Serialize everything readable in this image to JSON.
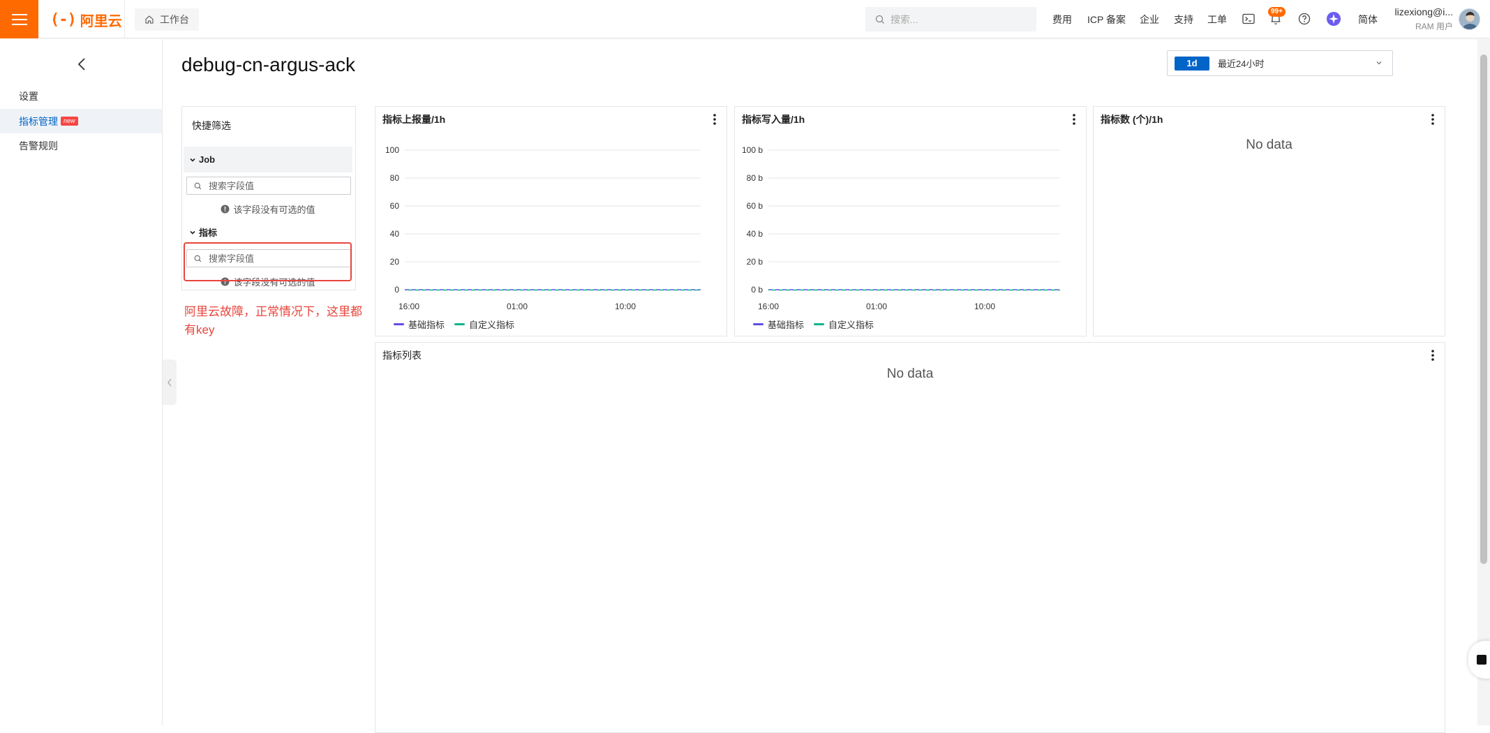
{
  "topbar": {
    "logo_text": "阿里云",
    "logo_mark": "(-)",
    "workbench_label": "工作台",
    "search_placeholder": "搜索...",
    "nav": {
      "billing": "费用",
      "icp": "ICP 备案",
      "enterprise": "企业",
      "support": "支持",
      "tickets": "工单",
      "language": "简体"
    },
    "notifications_badge": "99+",
    "user_name": "lizexiong@i...",
    "user_role": "RAM 用户"
  },
  "sidebar": {
    "items": [
      {
        "label": "设置",
        "active": false
      },
      {
        "label": "指标管理",
        "active": true,
        "badge": "new"
      },
      {
        "label": "告警规则",
        "active": false
      }
    ]
  },
  "main": {
    "title": "debug-cn-argus-ack",
    "time_range": {
      "tag": "1d",
      "label": "最近24小时"
    }
  },
  "quick_filter": {
    "title": "快捷筛选",
    "sections": [
      {
        "name": "Job",
        "search_placeholder": "搜索字段值",
        "empty_text": "该字段没有可选的值"
      },
      {
        "name": "指标",
        "search_placeholder": "搜索字段值",
        "empty_text": "该字段没有可选的值"
      }
    ]
  },
  "annotation": "阿里云故障，正常情况下，这里都有key",
  "panels": {
    "report_volume": {
      "title": "指标上报量/1h",
      "legend": [
        "基础指标",
        "自定义指标"
      ]
    },
    "write_volume": {
      "title": "指标写入量/1h",
      "legend": [
        "基础指标",
        "自定义指标"
      ]
    },
    "metric_count": {
      "title": "指标数 (个)/1h",
      "no_data": "No data"
    },
    "metric_list": {
      "title": "指标列表",
      "no_data": "No data"
    }
  },
  "colors": {
    "brand": "#ff6a00",
    "primary": "#0064c8",
    "series_basic": "#5f4de6",
    "series_custom": "#11b589",
    "annotation": "#e8453c"
  },
  "chart_data": [
    {
      "type": "line",
      "title": "指标上报量/1h",
      "x_ticks": [
        "16:00",
        "01:00",
        "10:00"
      ],
      "y_ticks": [
        "0",
        "20",
        "40",
        "60",
        "80",
        "100"
      ],
      "ylim": [
        0,
        100
      ],
      "series": [
        {
          "name": "基础指标",
          "values": [
            0,
            0,
            0
          ]
        },
        {
          "name": "自定义指标",
          "values": [
            0,
            0,
            0
          ]
        }
      ],
      "grid": true,
      "legend": "bottom-left"
    },
    {
      "type": "line",
      "title": "指标写入量/1h",
      "x_ticks": [
        "16:00",
        "01:00",
        "10:00"
      ],
      "y_ticks": [
        "0 b",
        "20 b",
        "40 b",
        "60 b",
        "80 b",
        "100 b"
      ],
      "ylim": [
        0,
        100
      ],
      "series": [
        {
          "name": "基础指标",
          "values": [
            0,
            0,
            0
          ]
        },
        {
          "name": "自定义指标",
          "values": [
            0,
            0,
            0
          ]
        }
      ],
      "grid": true,
      "legend": "bottom-left"
    }
  ]
}
